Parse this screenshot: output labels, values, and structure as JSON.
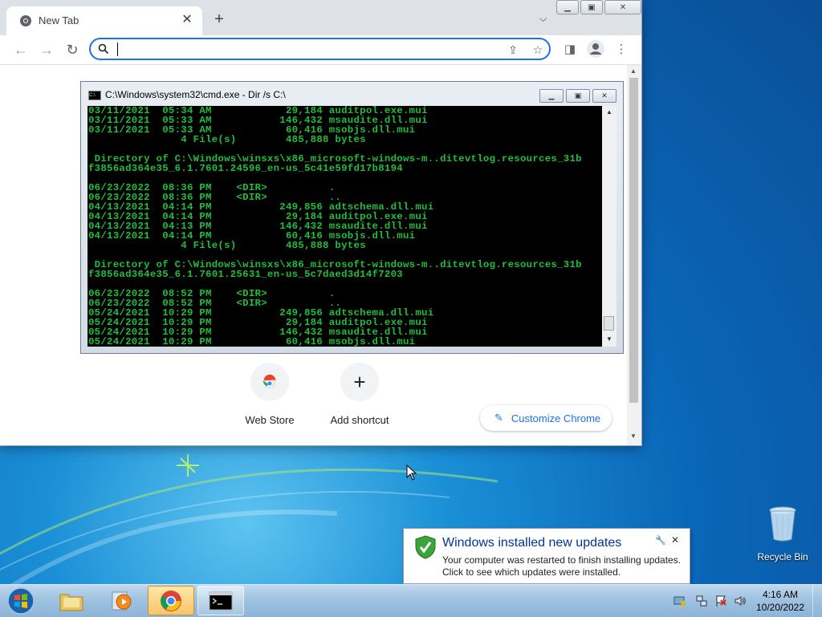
{
  "browser": {
    "tab_title": "New Tab",
    "tab_close": "✕",
    "new_tab": "+",
    "omnibox": {
      "value": "",
      "placeholder": ""
    },
    "shortcuts": [
      {
        "label": "Web Store",
        "icon": "chrome-web-store-icon"
      },
      {
        "label": "Add shortcut",
        "icon": "plus-icon",
        "glyph": "+"
      }
    ],
    "customize_label": "Customize Chrome",
    "accent_color": "#1a73e8"
  },
  "cmd": {
    "title": "C:\\Windows\\system32\\cmd.exe - Dir /s C:\\",
    "lines": [
      "03/11/2021  05:34 AM            29,184 auditpol.exe.mui",
      "03/11/2021  05:33 AM           146,432 msaudite.dll.mui",
      "03/11/2021  05:33 AM            60,416 msobjs.dll.mui",
      "               4 File(s)        485,888 bytes",
      "",
      " Directory of C:\\Windows\\winsxs\\x86_microsoft-windows-m..ditevtlog.resources_31b",
      "f3856ad364e35_6.1.7601.24596_en-us_5c41e59fd17b8194",
      "",
      "06/23/2022  08:36 PM    <DIR>          .",
      "06/23/2022  08:36 PM    <DIR>          ..",
      "04/13/2021  04:14 PM           249,856 adtschema.dll.mui",
      "04/13/2021  04:14 PM            29,184 auditpol.exe.mui",
      "04/13/2021  04:13 PM           146,432 msaudite.dll.mui",
      "04/13/2021  04:14 PM            60,416 msobjs.dll.mui",
      "               4 File(s)        485,888 bytes",
      "",
      " Directory of C:\\Windows\\winsxs\\x86_microsoft-windows-m..ditevtlog.resources_31b",
      "f3856ad364e35_6.1.7601.25631_en-us_5c7daed3d14f7203",
      "",
      "06/23/2022  08:52 PM    <DIR>          .",
      "06/23/2022  08:52 PM    <DIR>          ..",
      "05/24/2021  10:29 PM           249,856 adtschema.dll.mui",
      "05/24/2021  10:29 PM            29,184 auditpol.exe.mui",
      "05/24/2021  10:29 PM           146,432 msaudite.dll.mui",
      "05/24/2021  10:29 PM            60,416 msobjs.dll.mui"
    ],
    "text_color": "#1fbf3c"
  },
  "notification": {
    "title": "Windows installed new updates",
    "line1": "Your computer was restarted to finish installing updates.",
    "line2": "Click to see which updates were installed."
  },
  "desktop": {
    "recycle_bin_label": "Recycle Bin"
  },
  "taskbar": {
    "apps": [
      "windows-explorer-icon",
      "media-player-icon",
      "chrome-icon",
      "command-prompt-icon"
    ],
    "time": "4:16 AM",
    "date": "10/20/2022"
  }
}
